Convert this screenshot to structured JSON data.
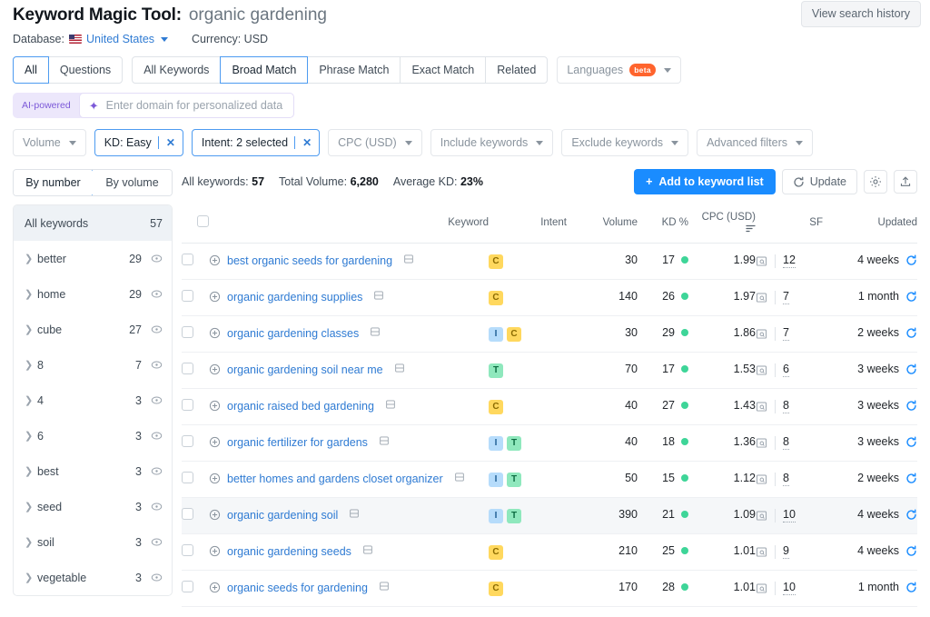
{
  "header": {
    "title_label": "Keyword Magic Tool:",
    "query": "organic gardening",
    "view_history_label": "View search history",
    "database_label": "Database:",
    "database_value": "United States",
    "currency_label": "Currency: USD"
  },
  "tabs": {
    "group1": [
      {
        "label": "All",
        "active": true
      },
      {
        "label": "Questions",
        "active": false
      }
    ],
    "group2": [
      {
        "label": "All Keywords",
        "active": false
      },
      {
        "label": "Broad Match",
        "active": true
      },
      {
        "label": "Phrase Match",
        "active": false
      },
      {
        "label": "Exact Match",
        "active": false
      },
      {
        "label": "Related",
        "active": false
      }
    ],
    "languages_label": "Languages",
    "languages_badge": "beta"
  },
  "ai_bar": {
    "tag": "AI-powered",
    "placeholder": "Enter domain for personalized data",
    "value": ""
  },
  "filters": [
    {
      "label": "Volume",
      "selected": false
    },
    {
      "label": "KD: Easy",
      "selected": true
    },
    {
      "label": "Intent: 2 selected",
      "selected": true
    },
    {
      "label": "CPC (USD)",
      "selected": false
    },
    {
      "label": "Include keywords",
      "selected": false
    },
    {
      "label": "Exclude keywords",
      "selected": false
    },
    {
      "label": "Advanced filters",
      "selected": false
    }
  ],
  "sidebar": {
    "sort_tabs": [
      {
        "label": "By number",
        "active": true
      },
      {
        "label": "By volume",
        "active": false
      }
    ],
    "all_keywords_label": "All keywords",
    "all_keywords_count": "57",
    "groups": [
      {
        "label": "better",
        "count": "29"
      },
      {
        "label": "home",
        "count": "29"
      },
      {
        "label": "cube",
        "count": "27"
      },
      {
        "label": "8",
        "count": "7"
      },
      {
        "label": "4",
        "count": "3"
      },
      {
        "label": "6",
        "count": "3"
      },
      {
        "label": "best",
        "count": "3"
      },
      {
        "label": "seed",
        "count": "3"
      },
      {
        "label": "soil",
        "count": "3"
      },
      {
        "label": "vegetable",
        "count": "3"
      }
    ]
  },
  "toolbar": {
    "all_keywords_label": "All keywords:",
    "all_keywords_value": "57",
    "total_volume_label": "Total Volume:",
    "total_volume_value": "6,280",
    "average_kd_label": "Average KD:",
    "average_kd_value": "23%",
    "add_to_list_label": "Add to keyword list",
    "update_label": "Update"
  },
  "table": {
    "columns": {
      "keyword": "Keyword",
      "intent": "Intent",
      "volume": "Volume",
      "kd": "KD %",
      "cpc": "CPC (USD)",
      "sf": "SF",
      "updated": "Updated"
    },
    "sorted_column": "cpc",
    "rows": [
      {
        "keyword": "best organic seeds for gardening",
        "intent": [
          "C"
        ],
        "volume": "30",
        "kd": "17",
        "cpc": "1.99",
        "sf": "12",
        "updated": "4 weeks",
        "highlight": false
      },
      {
        "keyword": "organic gardening supplies",
        "intent": [
          "C"
        ],
        "volume": "140",
        "kd": "26",
        "cpc": "1.97",
        "sf": "7",
        "updated": "1 month",
        "highlight": false
      },
      {
        "keyword": "organic gardening classes",
        "intent": [
          "I",
          "C"
        ],
        "volume": "30",
        "kd": "29",
        "cpc": "1.86",
        "sf": "7",
        "updated": "2 weeks",
        "highlight": false
      },
      {
        "keyword": "organic gardening soil near me",
        "intent": [
          "T"
        ],
        "volume": "70",
        "kd": "17",
        "cpc": "1.53",
        "sf": "6",
        "updated": "3 weeks",
        "highlight": false
      },
      {
        "keyword": "organic raised bed gardening",
        "intent": [
          "C"
        ],
        "volume": "40",
        "kd": "27",
        "cpc": "1.43",
        "sf": "8",
        "updated": "3 weeks",
        "highlight": false
      },
      {
        "keyword": "organic fertilizer for gardens",
        "intent": [
          "I",
          "T"
        ],
        "volume": "40",
        "kd": "18",
        "cpc": "1.36",
        "sf": "8",
        "updated": "3 weeks",
        "highlight": false
      },
      {
        "keyword": "better homes and gardens closet organizer",
        "intent": [
          "I",
          "T"
        ],
        "volume": "50",
        "kd": "15",
        "cpc": "1.12",
        "sf": "8",
        "updated": "2 weeks",
        "highlight": false
      },
      {
        "keyword": "organic gardening soil",
        "intent": [
          "I",
          "T"
        ],
        "volume": "390",
        "kd": "21",
        "cpc": "1.09",
        "sf": "10",
        "updated": "4 weeks",
        "highlight": true
      },
      {
        "keyword": "organic gardening seeds",
        "intent": [
          "C"
        ],
        "volume": "210",
        "kd": "25",
        "cpc": "1.01",
        "sf": "9",
        "updated": "4 weeks",
        "highlight": false
      },
      {
        "keyword": "organic seeds for gardening",
        "intent": [
          "C"
        ],
        "volume": "170",
        "kd": "28",
        "cpc": "1.01",
        "sf": "10",
        "updated": "1 month",
        "highlight": false
      }
    ]
  },
  "colors": {
    "accent_blue": "#1a8cff",
    "link_blue": "#2f7bd3",
    "kd_easy_green": "#3ed598",
    "intent_c": "#ffd85e",
    "intent_i": "#b6dcfb",
    "intent_t": "#8fe8bd",
    "ai_purple": "#7c59d8",
    "beta_orange": "#ff642d"
  }
}
